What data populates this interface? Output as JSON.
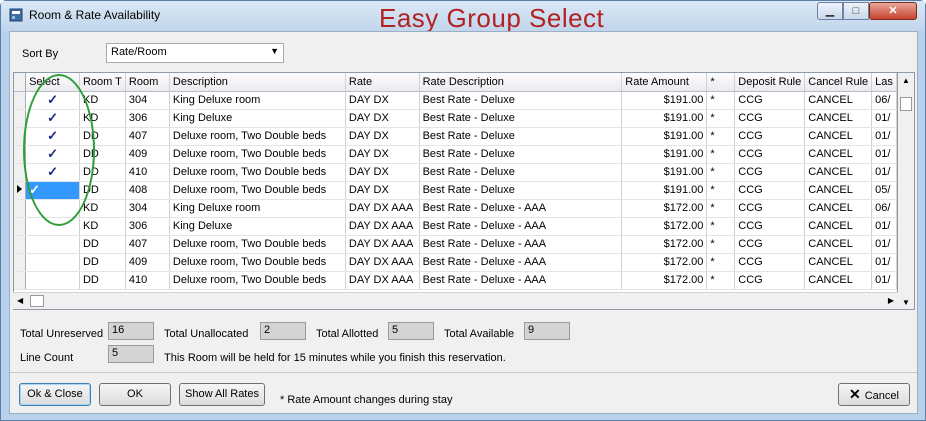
{
  "window": {
    "title": "Room & Rate Availability",
    "banner": "Easy Group Select"
  },
  "sort": {
    "label": "Sort By",
    "value": "Rate/Room"
  },
  "grid": {
    "columns": [
      "Select",
      "Room T",
      "Room",
      "Description",
      "Rate",
      "Rate Description",
      "Rate Amount",
      "*",
      "Deposit Rule",
      "Cancel Rule",
      "Las"
    ],
    "rows": [
      {
        "select": "✓",
        "room_type": "KD",
        "room": "304",
        "description": "King Deluxe room",
        "rate": "DAY DX",
        "rate_description": "Best Rate - Deluxe",
        "rate_amount": "$191.00",
        "star": "*",
        "deposit_rule": "CCG",
        "cancel_rule": "CANCEL",
        "last": "06/"
      },
      {
        "select": "✓",
        "room_type": "KD",
        "room": "306",
        "description": "King Deluxe",
        "rate": "DAY DX",
        "rate_description": "Best Rate - Deluxe",
        "rate_amount": "$191.00",
        "star": "*",
        "deposit_rule": "CCG",
        "cancel_rule": "CANCEL",
        "last": "01/"
      },
      {
        "select": "✓",
        "room_type": "DD",
        "room": "407",
        "description": "Deluxe room, Two Double beds",
        "rate": "DAY DX",
        "rate_description": "Best Rate - Deluxe",
        "rate_amount": "$191.00",
        "star": "*",
        "deposit_rule": "CCG",
        "cancel_rule": "CANCEL",
        "last": "01/"
      },
      {
        "select": "✓",
        "room_type": "DD",
        "room": "409",
        "description": "Deluxe room, Two Double beds",
        "rate": "DAY DX",
        "rate_description": "Best Rate - Deluxe",
        "rate_amount": "$191.00",
        "star": "*",
        "deposit_rule": "CCG",
        "cancel_rule": "CANCEL",
        "last": "01/"
      },
      {
        "select": "✓",
        "room_type": "DD",
        "room": "410",
        "description": "Deluxe room, Two Double beds",
        "rate": "DAY DX",
        "rate_description": "Best Rate - Deluxe",
        "rate_amount": "$191.00",
        "star": "*",
        "deposit_rule": "CCG",
        "cancel_rule": "CANCEL",
        "last": "01/"
      },
      {
        "select": "✓",
        "room_type": "DD",
        "room": "408",
        "description": "Deluxe room, Two Double beds",
        "rate": "DAY DX",
        "rate_description": "Best Rate - Deluxe",
        "rate_amount": "$191.00",
        "star": "*",
        "deposit_rule": "CCG",
        "cancel_rule": "CANCEL",
        "last": "05/",
        "current": true
      },
      {
        "select": "",
        "room_type": "KD",
        "room": "304",
        "description": "King Deluxe room",
        "rate": "DAY DX AAA",
        "rate_description": "Best Rate - Deluxe - AAA",
        "rate_amount": "$172.00",
        "star": "*",
        "deposit_rule": "CCG",
        "cancel_rule": "CANCEL",
        "last": "06/"
      },
      {
        "select": "",
        "room_type": "KD",
        "room": "306",
        "description": "King Deluxe",
        "rate": "DAY DX AAA",
        "rate_description": "Best Rate - Deluxe - AAA",
        "rate_amount": "$172.00",
        "star": "*",
        "deposit_rule": "CCG",
        "cancel_rule": "CANCEL",
        "last": "01/"
      },
      {
        "select": "",
        "room_type": "DD",
        "room": "407",
        "description": "Deluxe room, Two Double beds",
        "rate": "DAY DX AAA",
        "rate_description": "Best Rate - Deluxe - AAA",
        "rate_amount": "$172.00",
        "star": "*",
        "deposit_rule": "CCG",
        "cancel_rule": "CANCEL",
        "last": "01/"
      },
      {
        "select": "",
        "room_type": "DD",
        "room": "409",
        "description": "Deluxe room, Two Double beds",
        "rate": "DAY DX AAA",
        "rate_description": "Best Rate - Deluxe - AAA",
        "rate_amount": "$172.00",
        "star": "*",
        "deposit_rule": "CCG",
        "cancel_rule": "CANCEL",
        "last": "01/"
      },
      {
        "select": "",
        "room_type": "DD",
        "room": "410",
        "description": "Deluxe room, Two Double beds",
        "rate": "DAY DX AAA",
        "rate_description": "Best Rate - Deluxe - AAA",
        "rate_amount": "$172.00",
        "star": "*",
        "deposit_rule": "CCG",
        "cancel_rule": "CANCEL",
        "last": "01/"
      }
    ]
  },
  "stats": {
    "total_unreserved_label": "Total Unreserved",
    "total_unreserved": "16",
    "total_unallocated_label": "Total Unallocated",
    "total_unallocated": "2",
    "total_allotted_label": "Total Allotted",
    "total_allotted": "5",
    "total_available_label": "Total Available",
    "total_available": "9",
    "line_count_label": "Line Count",
    "line_count": "5",
    "hold_message": "This Room will be held for 15 minutes while you finish this reservation."
  },
  "buttons": {
    "ok_close": "Ok & Close",
    "ok": "OK",
    "show_all_rates": "Show All Rates",
    "cancel": "Cancel"
  },
  "note": "* Rate Amount changes during stay",
  "colors": {
    "banner": "#b22222",
    "selected_cell": "#3399ff",
    "annotation_oval": "#2e9e3a"
  }
}
